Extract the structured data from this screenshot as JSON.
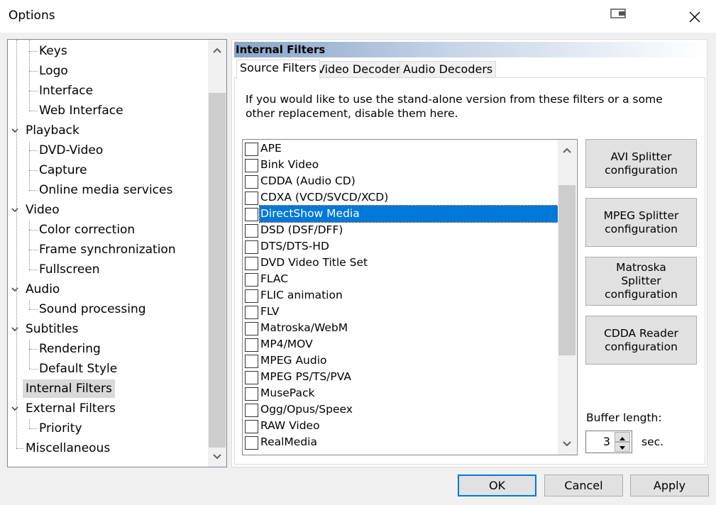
{
  "window": {
    "title": "Options"
  },
  "tree": {
    "items": [
      {
        "label": "Keys",
        "level": 2
      },
      {
        "label": "Logo",
        "level": 2
      },
      {
        "label": "Interface",
        "level": 2
      },
      {
        "label": "Web Interface",
        "level": 2
      },
      {
        "label": "Playback",
        "level": 1,
        "expanded": true
      },
      {
        "label": "DVD-Video",
        "level": 2
      },
      {
        "label": "Capture",
        "level": 2
      },
      {
        "label": "Online media services",
        "level": 2
      },
      {
        "label": "Video",
        "level": 1,
        "expanded": true
      },
      {
        "label": "Color correction",
        "level": 2
      },
      {
        "label": "Frame synchronization",
        "level": 2
      },
      {
        "label": "Fullscreen",
        "level": 2
      },
      {
        "label": "Audio",
        "level": 1,
        "expanded": true
      },
      {
        "label": "Sound processing",
        "level": 2
      },
      {
        "label": "Subtitles",
        "level": 1,
        "expanded": true
      },
      {
        "label": "Rendering",
        "level": 2
      },
      {
        "label": "Default Style",
        "level": 2
      },
      {
        "label": "Internal Filters",
        "level": 1,
        "selected": true
      },
      {
        "label": "External Filters",
        "level": 1,
        "expanded": true
      },
      {
        "label": "Priority",
        "level": 2
      },
      {
        "label": "Miscellaneous",
        "level": 1
      }
    ]
  },
  "panel": {
    "header": "Internal Filters",
    "tabs": [
      {
        "label": "Source Filters",
        "active": true
      },
      {
        "label": "Video Decoders"
      },
      {
        "label": "Audio Decoders"
      }
    ],
    "description": "If you would like to use the stand-alone version from these filters or a some other replacement, disable them here.",
    "filters": [
      {
        "label": "APE"
      },
      {
        "label": "Bink Video"
      },
      {
        "label": "CDDA (Audio CD)"
      },
      {
        "label": "CDXA (VCD/SVCD/XCD)"
      },
      {
        "label": "DirectShow Media",
        "selected": true
      },
      {
        "label": "DSD (DSF/DFF)"
      },
      {
        "label": "DTS/DTS-HD"
      },
      {
        "label": "DVD Video Title Set"
      },
      {
        "label": "FLAC"
      },
      {
        "label": "FLIC animation"
      },
      {
        "label": "FLV"
      },
      {
        "label": "Matroska/WebM"
      },
      {
        "label": "MP4/MOV"
      },
      {
        "label": "MPEG Audio"
      },
      {
        "label": "MPEG PS/TS/PVA"
      },
      {
        "label": "MusePack"
      },
      {
        "label": "Ogg/Opus/Speex"
      },
      {
        "label": "RAW Video"
      },
      {
        "label": "RealMedia"
      }
    ],
    "config_buttons": [
      {
        "label": "AVI Splitter configuration"
      },
      {
        "label": "MPEG Splitter configuration"
      },
      {
        "label": "Matroska Splitter configuration"
      },
      {
        "label": "CDDA Reader configuration"
      }
    ],
    "buffer": {
      "label": "Buffer length:",
      "value": "3",
      "unit": "sec."
    }
  },
  "footer": {
    "ok": "OK",
    "cancel": "Cancel",
    "apply": "Apply"
  },
  "colors": {
    "selection": "#0078d7",
    "header_gradient_start": "#8aa4c8"
  }
}
